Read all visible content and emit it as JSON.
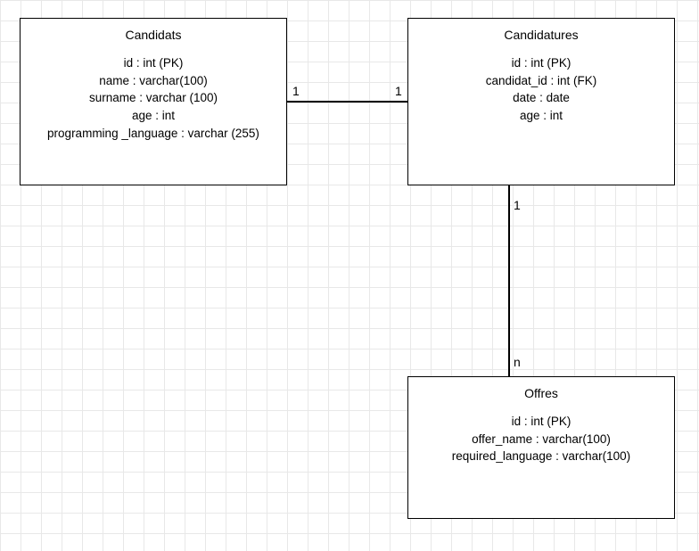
{
  "entities": {
    "candidats": {
      "title": "Candidats",
      "attrs": [
        "id : int (PK)",
        "name : varchar(100)",
        "surname : varchar (100)",
        "age : int",
        "programming _language : varchar (255)"
      ]
    },
    "candidatures": {
      "title": "Candidatures",
      "attrs": [
        "id : int (PK)",
        "candidat_id : int (FK)",
        "date : date",
        "age : int"
      ]
    },
    "offres": {
      "title": "Offres",
      "attrs": [
        "id : int (PK)",
        "offer_name : varchar(100)",
        "required_language : varchar(100)"
      ]
    }
  },
  "relations": {
    "candidats_candidatures": {
      "left": "1",
      "right": "1"
    },
    "candidatures_offres": {
      "top": "1",
      "bottom": "n"
    }
  }
}
